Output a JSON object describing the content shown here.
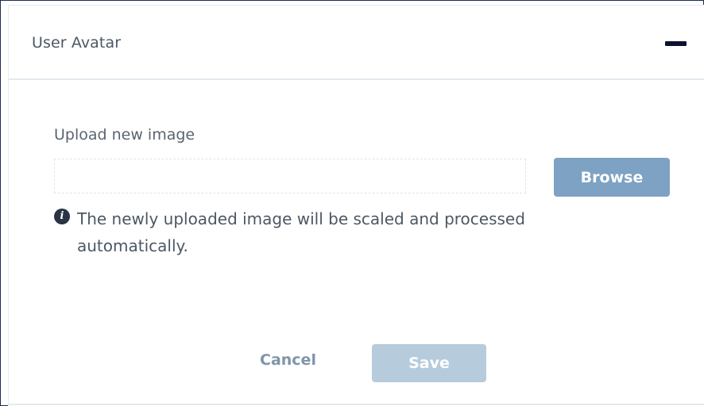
{
  "panel": {
    "title": "User Avatar",
    "collapse_icon": "minus-icon"
  },
  "upload": {
    "label": "Upload new image",
    "file_value": "",
    "browse_label": "Browse",
    "info_icon": "info-circle-icon",
    "info_text": "The newly uploaded image will be scaled and processed automatically."
  },
  "actions": {
    "cancel_label": "Cancel",
    "save_label": "Save"
  },
  "colors": {
    "browse_button": "#7da2c3",
    "save_button_disabled": "#b6cbdc",
    "cancel_text": "#7f95aa",
    "frame_border": "#1d2b55"
  }
}
